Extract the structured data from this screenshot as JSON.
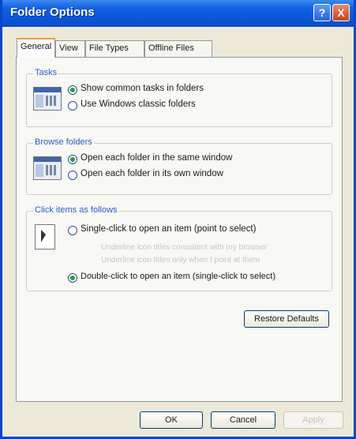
{
  "window": {
    "title": "Folder Options"
  },
  "titlebar": {
    "help_glyph": "?",
    "close_glyph": "X"
  },
  "tabs": [
    {
      "label": "General",
      "active": true
    },
    {
      "label": "View",
      "active": false
    },
    {
      "label": "File Types",
      "active": false
    },
    {
      "label": "Offline Files",
      "active": false
    }
  ],
  "tasks": {
    "title": "Tasks",
    "options": [
      {
        "label": "Show common tasks in folders",
        "selected": true
      },
      {
        "label": "Use Windows classic folders",
        "selected": false
      }
    ]
  },
  "browse_folders": {
    "title": "Browse folders",
    "options": [
      {
        "label": "Open each folder in the same window",
        "selected": true
      },
      {
        "label": "Open each folder in its own window",
        "selected": false
      }
    ]
  },
  "click_items": {
    "title": "Click items as follows",
    "single_click": {
      "label": "Single-click to open an item (point to select)",
      "selected": false
    },
    "sub_options": [
      {
        "label": "Underline icon titles consistent with my browser",
        "enabled": false
      },
      {
        "label": "Underline icon titles only when I point at them",
        "enabled": false
      }
    ],
    "double_click": {
      "label": "Double-click to open an item (single-click to select)",
      "selected": true
    }
  },
  "restore_defaults": {
    "label": "Restore Defaults"
  },
  "footer": {
    "ok_label": "OK",
    "cancel_label": "Cancel",
    "apply_label": "Apply"
  }
}
